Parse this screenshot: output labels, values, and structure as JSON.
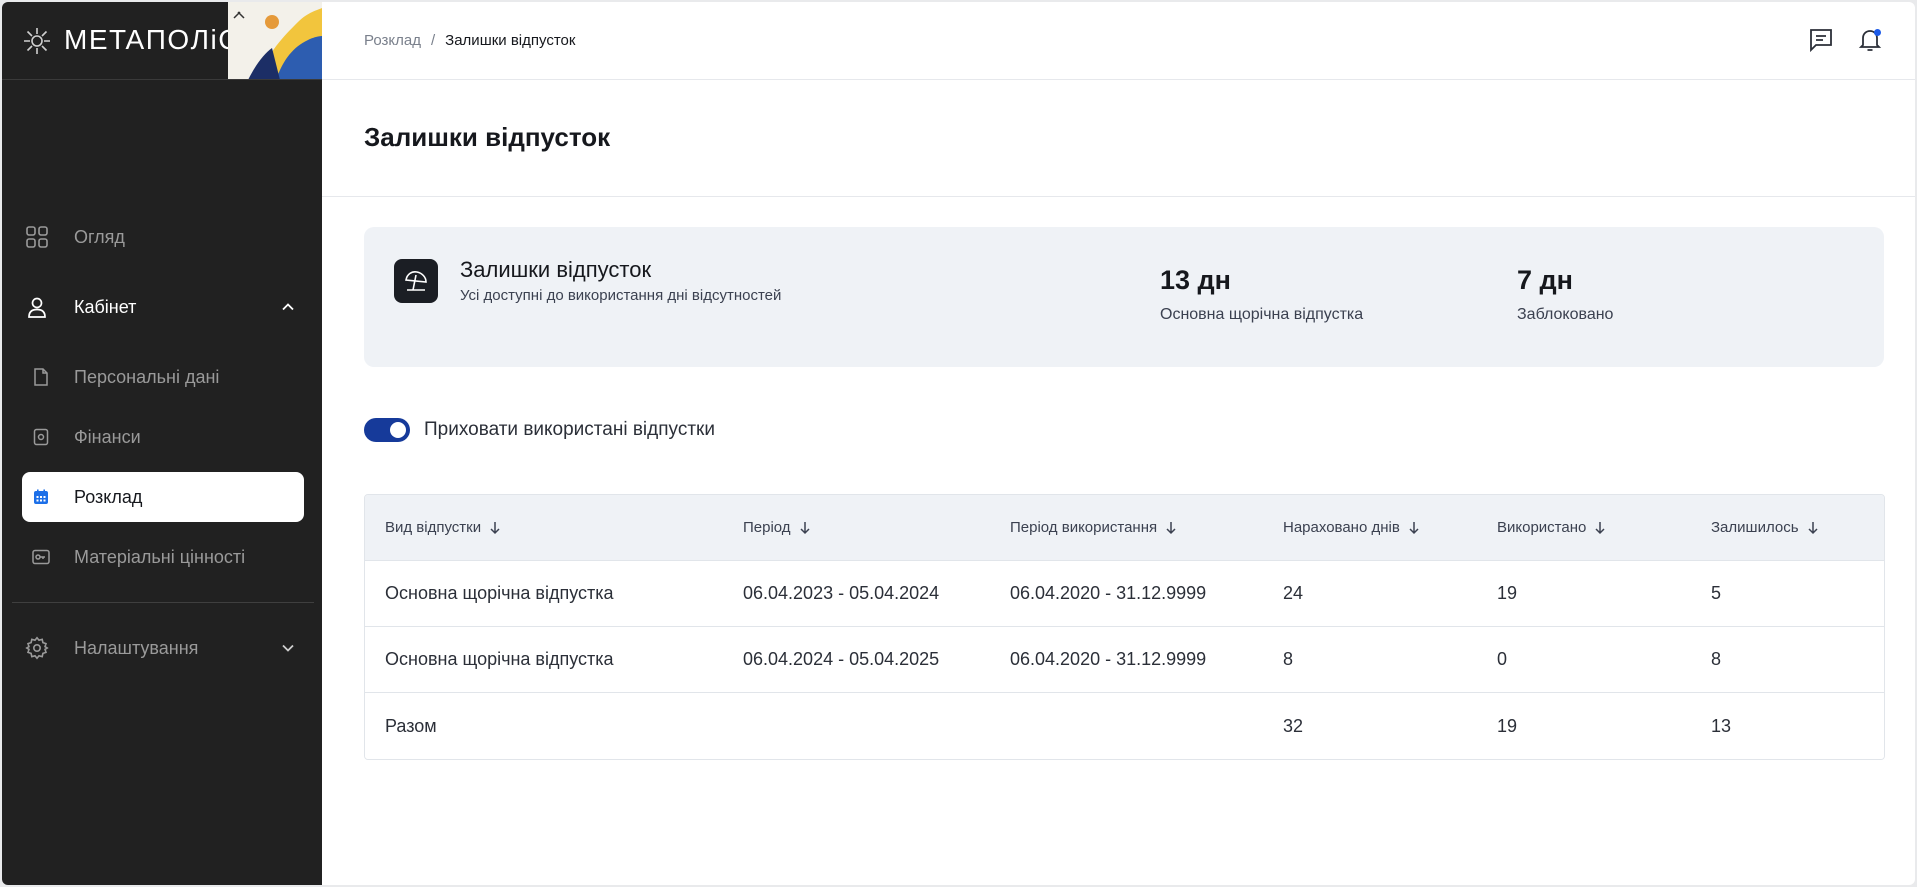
{
  "app": {
    "logo_text": "METAПOЛiC"
  },
  "sidebar": {
    "overview": "Огляд",
    "cabinet": "Кабінет",
    "sub_items": {
      "personal": "Персональні дані",
      "finance": "Фінанси",
      "schedule": "Розклад",
      "assets": "Матеріальні цінності"
    },
    "settings": "Налаштування"
  },
  "breadcrumb": {
    "parent": "Розклад",
    "separator": "/",
    "current": "Залишки відпусток"
  },
  "page": {
    "title": "Залишки відпусток"
  },
  "summary": {
    "title": "Залишки відпусток",
    "subtitle": "Усі доступні до використання дні відсутностей",
    "stats": [
      {
        "value": "13 дн",
        "label": "Основна щорічна відпустка"
      },
      {
        "value": "7 дн",
        "label": "Заблоковано"
      }
    ]
  },
  "toggle": {
    "label": "Приховати використані відпустки",
    "on": true
  },
  "table": {
    "headers": [
      "Вид відпустки",
      "Період",
      "Період використання",
      "Нараховано днів",
      "Використано",
      "Залишилось"
    ],
    "rows": [
      [
        "Основна щорічна відпустка",
        "06.04.2023 - 05.04.2024",
        "06.04.2020 - 31.12.9999",
        "24",
        "19",
        "5"
      ],
      [
        "Основна щорічна відпустка",
        "06.04.2024 - 05.04.2025",
        "06.04.2020 - 31.12.9999",
        "8",
        "0",
        "8"
      ]
    ],
    "total": [
      "Разом",
      "",
      "",
      "32",
      "19",
      "13"
    ]
  },
  "colors": {
    "sidebar_bg": "#212121",
    "accent": "#1c5be8",
    "toggle_on": "#163a9a",
    "card_bg": "#eff2f6"
  }
}
